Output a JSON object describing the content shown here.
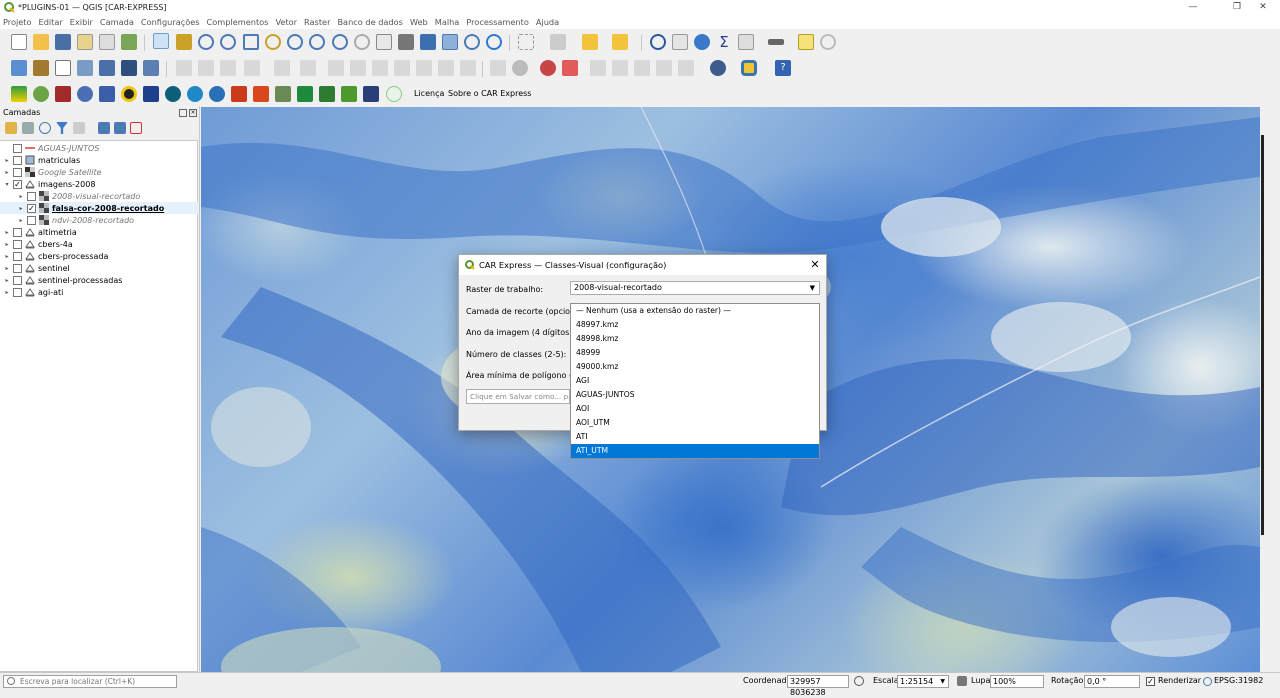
{
  "window": {
    "title": "*PLUGINS-01 — QGIS [CAR-EXPRESS]",
    "minimize": "—",
    "maximize": "❐",
    "close": "✕"
  },
  "menu": [
    "Projeto",
    "Editar",
    "Exibir",
    "Camada",
    "Configurações",
    "Complementos",
    "Vetor",
    "Raster",
    "Banco de dados",
    "Web",
    "Malha",
    "Processamento",
    "Ajuda"
  ],
  "plugin_toolbar": {
    "licenca": "Licença",
    "sobre": "Sobre o CAR Express"
  },
  "layers_panel": {
    "title": "Camadas",
    "layers": [
      {
        "name": "AGUAS-JUNTOS",
        "checked": false,
        "style": "italic",
        "icon": "line-layer-icon",
        "indent": 0,
        "expand": ""
      },
      {
        "name": "matriculas",
        "checked": false,
        "style": "normal",
        "icon": "polygon-layer-icon",
        "indent": 0,
        "expand": "▸"
      },
      {
        "name": "Google Satellite",
        "checked": false,
        "style": "italic",
        "icon": "xyz-tile-icon",
        "indent": 0,
        "expand": "▸"
      },
      {
        "name": "imagens-2008",
        "checked": true,
        "style": "normal",
        "icon": "group-icon",
        "indent": 0,
        "expand": "▾"
      },
      {
        "name": "2008-visual-recortado",
        "checked": false,
        "style": "italic",
        "icon": "raster-layer-icon",
        "indent": 1,
        "expand": "▸"
      },
      {
        "name": "falsa-cor-2008-recortado",
        "checked": true,
        "style": "bold",
        "icon": "raster-layer-icon",
        "indent": 1,
        "expand": "▸"
      },
      {
        "name": "ndvi-2008-recortado",
        "checked": false,
        "style": "italic",
        "icon": "raster-layer-icon",
        "indent": 1,
        "expand": "▸"
      },
      {
        "name": "altimetria",
        "checked": false,
        "style": "normal",
        "icon": "group-icon",
        "indent": 0,
        "expand": "▸"
      },
      {
        "name": "cbers-4a",
        "checked": false,
        "style": "normal",
        "icon": "group-icon",
        "indent": 0,
        "expand": "▸"
      },
      {
        "name": "cbers-processada",
        "checked": false,
        "style": "normal",
        "icon": "group-icon",
        "indent": 0,
        "expand": "▸"
      },
      {
        "name": "sentinel",
        "checked": false,
        "style": "normal",
        "icon": "group-icon",
        "indent": 0,
        "expand": "▸"
      },
      {
        "name": "sentinel-processadas",
        "checked": false,
        "style": "normal",
        "icon": "group-icon",
        "indent": 0,
        "expand": "▸"
      },
      {
        "name": "agi-ati",
        "checked": false,
        "style": "normal",
        "icon": "group-icon",
        "indent": 0,
        "expand": "▸"
      }
    ]
  },
  "dialog": {
    "title": "CAR Express — Classes-Visual (configuração)",
    "close": "✕",
    "raster_label": "Raster de trabalho:",
    "raster_value": "2008-visual-recortado",
    "clip_label": "Camada de recorte (opcional):",
    "year_label": "Ano da imagem (4 dígitos):",
    "classes_label": "Número de classes (2-5):",
    "area_label": "Área mínima de polígono (ha):",
    "output_placeholder": "Clique em Salvar como... para es"
  },
  "dropdown": {
    "items": [
      "— Nenhum (usa a extensão do raster) —",
      "48997.kmz",
      "48998.kmz",
      "48999",
      "49000.kmz",
      "AGI",
      "AGUAS-JUNTOS",
      "AOI",
      "AOI_UTM",
      "ATI",
      "ATI_UTM"
    ],
    "selected_index": 10
  },
  "statusbar": {
    "locator_placeholder": "Escreva para localizar (Ctrl+K)",
    "coord_label": "Coordenada",
    "coord_value": "329957  8036238",
    "scale_label": "Escala",
    "scale_value": "1:25154",
    "lupa_label": "Lupa",
    "lupa_value": "100%",
    "rotation_label": "Rotação",
    "rotation_value": "0,0 °",
    "render_label": "Renderizar",
    "crs": "EPSG:31982"
  },
  "colors": {
    "accent": "#0078d7",
    "qgis_green": "#589632",
    "map_blue": "#3a73c9"
  }
}
